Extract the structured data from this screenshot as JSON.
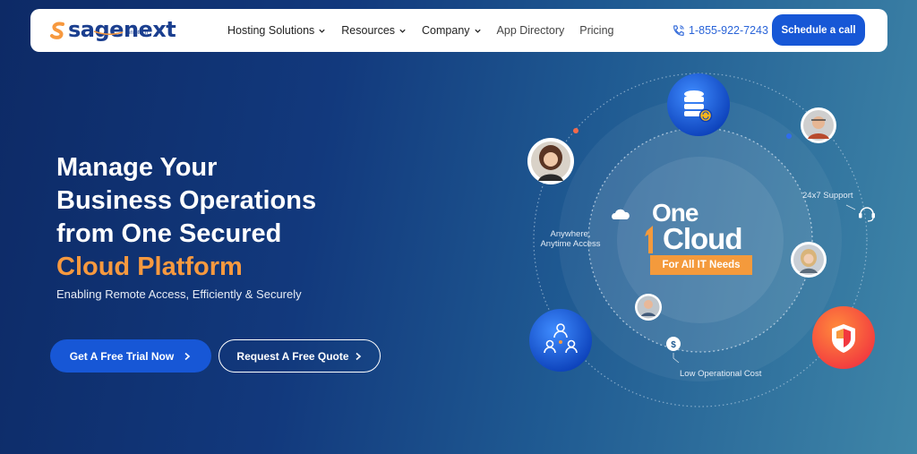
{
  "brand": {
    "name": "sagenext",
    "sub": "infotech"
  },
  "nav": {
    "items": [
      {
        "label": "Hosting Solutions",
        "dropdown": true
      },
      {
        "label": "Resources",
        "dropdown": true
      },
      {
        "label": "Company",
        "dropdown": true
      },
      {
        "label": "App Directory",
        "dropdown": false
      },
      {
        "label": "Pricing",
        "dropdown": false
      }
    ],
    "phone": "1-855-922-7243",
    "cta": "Schedule a call"
  },
  "hero": {
    "title_lines": [
      "Manage Your",
      "Business Operations",
      "from One Secured"
    ],
    "title_accent": "Cloud Platform",
    "subtitle": "Enabling Remote Access, Efficiently & Securely",
    "primary_button": "Get A Free Trial Now",
    "secondary_button": "Request A Free Quote"
  },
  "diagram": {
    "center_one": "One",
    "center_cloud": "Cloud",
    "center_tag": "For All IT Needs",
    "label_anywhere_1": "Anywhere,",
    "label_anywhere_2": "Anytime Access",
    "label_support": "24x7 Support",
    "label_cost": "Low Operational Cost"
  },
  "colors": {
    "accent": "#f7993f",
    "primary": "#1757d6",
    "background_start": "#0d2a66",
    "background_end": "#3f86a8"
  },
  "icons": [
    "database-icon",
    "network-users-icon",
    "shield-icon",
    "cloud-icon",
    "headset-icon",
    "dollar-icon",
    "phone-icon"
  ]
}
